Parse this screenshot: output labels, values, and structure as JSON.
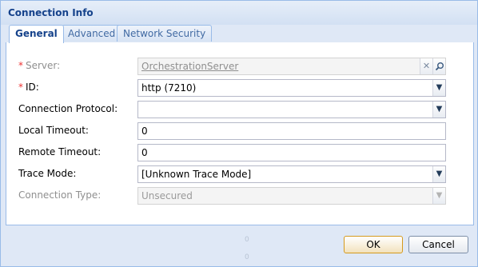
{
  "window": {
    "title": "Connection Info"
  },
  "tabs": [
    {
      "label": "General",
      "active": true
    },
    {
      "label": "Advanced",
      "active": false
    },
    {
      "label": "Network Security",
      "active": false
    }
  ],
  "form": {
    "server": {
      "required_mark": "*",
      "label": "Server:",
      "value": "OrchestrationServer",
      "clear_icon": "close-icon",
      "search_icon": "search-icon"
    },
    "id": {
      "required_mark": "*",
      "label": "ID:",
      "value": "http (7210)",
      "trigger_icon": "chevron-down-icon"
    },
    "connection_protocol": {
      "label": "Connection Protocol:",
      "value": "",
      "trigger_icon": "chevron-down-icon"
    },
    "local_timeout": {
      "label": "Local Timeout:",
      "value": "0"
    },
    "remote_timeout": {
      "label": "Remote Timeout:",
      "value": "0"
    },
    "trace_mode": {
      "label": "Trace Mode:",
      "value": "[Unknown Trace Mode]",
      "trigger_icon": "chevron-down-icon"
    },
    "connection_type": {
      "label": "Connection Type:",
      "value": "Unsecured",
      "trigger_icon": "chevron-down-icon",
      "disabled": true
    }
  },
  "buttons": {
    "ok": "OK",
    "cancel": "Cancel"
  },
  "background_marks": {
    "left": "0",
    "right": "0"
  },
  "colors": {
    "title": "#15428b",
    "required": "#e33333",
    "border": "#99bbe8",
    "ok_border": "#d59a1e"
  }
}
